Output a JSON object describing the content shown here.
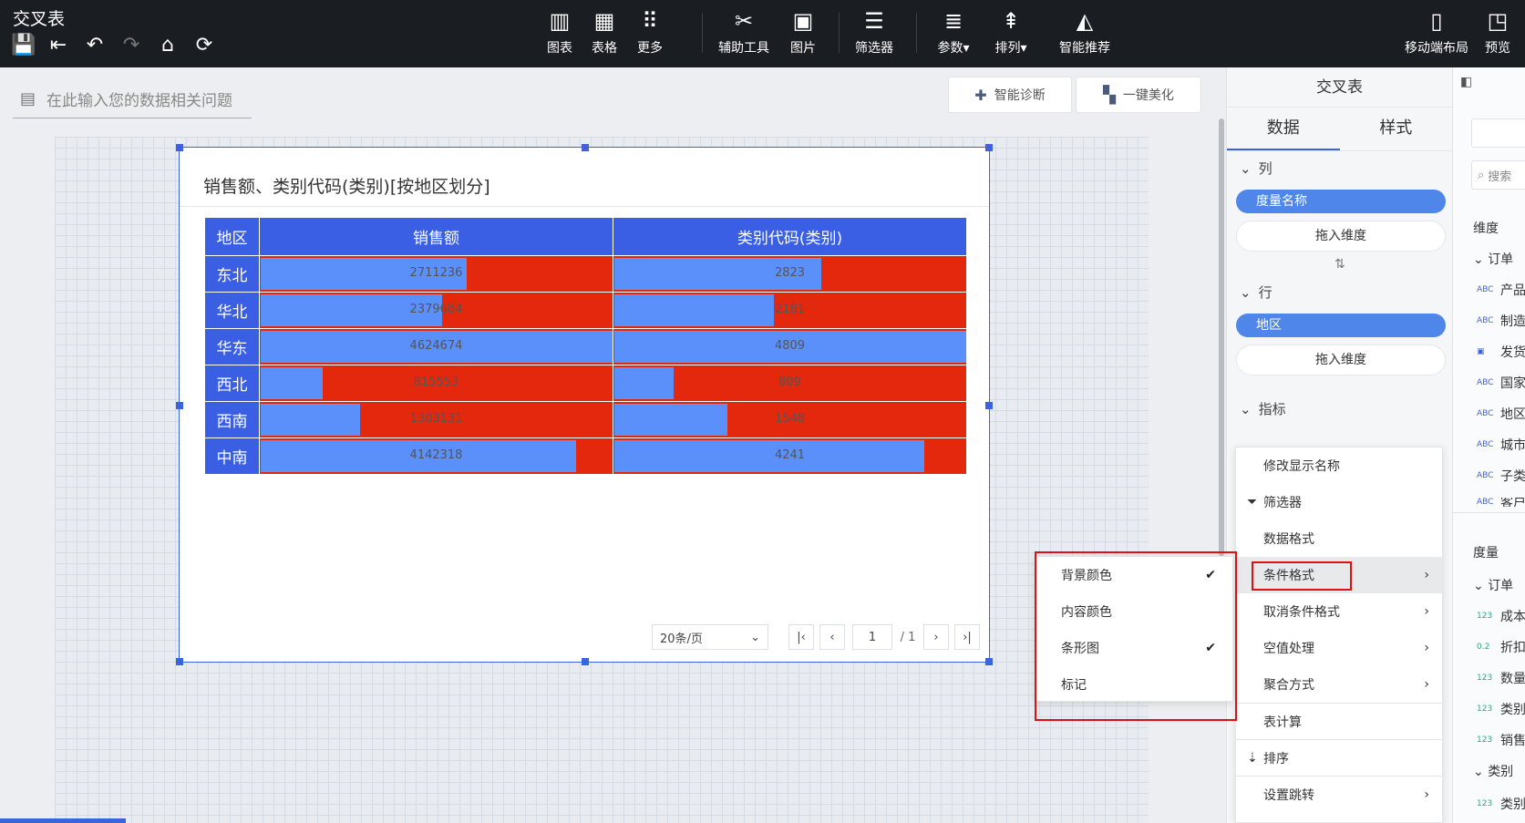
{
  "app": {
    "title": "交叉表"
  },
  "toolbar": {
    "tools": [
      {
        "icon": "bar-chart-icon",
        "label": "图表"
      },
      {
        "icon": "table-icon",
        "label": "表格"
      },
      {
        "icon": "grid-more-icon",
        "label": "更多"
      },
      {
        "icon": "tools-icon",
        "label": "辅助工具"
      },
      {
        "icon": "image-icon",
        "label": "图片"
      },
      {
        "icon": "filter-list-icon",
        "label": "筛选器"
      },
      {
        "icon": "sliders-icon",
        "label": "参数"
      },
      {
        "icon": "arrange-icon",
        "label": "排列"
      },
      {
        "icon": "smart-chart-icon",
        "label": "智能推荐"
      },
      {
        "icon": "mobile-icon",
        "label": "移动端布局"
      },
      {
        "icon": "preview-icon",
        "label": "预览"
      }
    ]
  },
  "question_bar": {
    "placeholder": "在此输入您的数据相关问题"
  },
  "actions": {
    "diagnose": "智能诊断",
    "beautify": "一键美化"
  },
  "widget": {
    "title": "销售额、类别代码(类别)[按地区划分]",
    "headers": [
      "地区",
      "销售额",
      "类别代码(类别)"
    ],
    "rows": [
      {
        "region": "东北",
        "sales": "2711236",
        "code": "2823"
      },
      {
        "region": "华北",
        "sales": "2379684",
        "code": "2181"
      },
      {
        "region": "华东",
        "sales": "4624674",
        "code": "4809"
      },
      {
        "region": "西北",
        "sales": "815553",
        "code": "809"
      },
      {
        "region": "西南",
        "sales": "1303131",
        "code": "1548"
      },
      {
        "region": "中南",
        "sales": "4142318",
        "code": "4241"
      }
    ],
    "bar_fraction": {
      "sales": [
        0.586,
        0.515,
        1.0,
        0.176,
        0.282,
        0.896
      ],
      "code": [
        0.587,
        0.454,
        1.0,
        0.168,
        0.322,
        0.882
      ]
    },
    "pager": {
      "page_size": "20条/页",
      "current": "1",
      "total": "/ 1"
    }
  },
  "right_panel": {
    "title": "交叉表",
    "tabs": [
      "数据",
      "样式"
    ],
    "columns_label": "列",
    "columns_field": "度量名称",
    "drop_hint": "拖入维度",
    "rows_label": "行",
    "rows_field": "地区",
    "measures_label": "指标"
  },
  "field_panel": {
    "search": "搜索",
    "dimension_label": "维度",
    "groups": [
      {
        "name": "订单"
      },
      {
        "name": "产品"
      },
      {
        "name": "制造"
      },
      {
        "name": "发货"
      },
      {
        "name": "国家"
      },
      {
        "name": "地区"
      },
      {
        "name": "城市"
      },
      {
        "name": "子类"
      },
      {
        "name": "客户"
      }
    ],
    "measure_label": "度量",
    "measure_group": "订单",
    "measures": [
      {
        "type": "123",
        "name": "成本"
      },
      {
        "type": "0.2",
        "name": "折扣"
      },
      {
        "type": "123",
        "name": "数量"
      },
      {
        "type": "123",
        "name": "类别"
      },
      {
        "type": "123",
        "name": "销售"
      }
    ],
    "category_group": "类别",
    "category_measure": {
      "type": "123",
      "name": "类别"
    }
  },
  "context_menu": {
    "items": [
      "修改显示名称",
      "筛选器",
      "数据格式",
      "条件格式",
      "取消条件格式",
      "空值处理",
      "聚合方式",
      "表计算",
      "排序",
      "设置跳转"
    ]
  },
  "submenu": {
    "items": [
      "背景颜色",
      "内容颜色",
      "条形图",
      "标记"
    ]
  },
  "colors": {
    "header_blue": "#3a5fe5",
    "cell_red": "#e3280e",
    "bar_blue": "#5b8ff9",
    "highlight_box": "#dd1111"
  }
}
